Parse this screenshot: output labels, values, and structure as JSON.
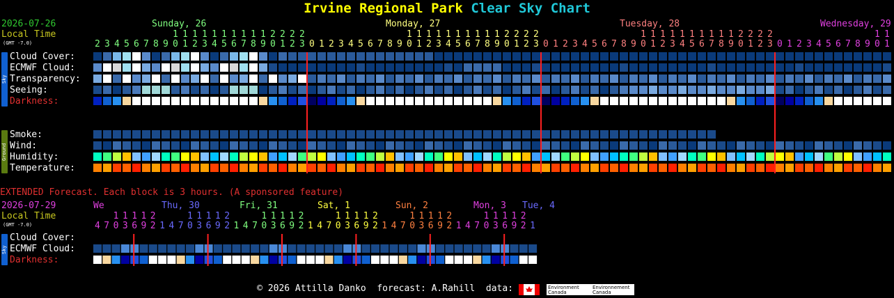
{
  "title": {
    "park": "Irvine Regional Park",
    "brand": "Clear Sky Chart"
  },
  "colors": {
    "park": "#ffff00",
    "brand": "#20c8d8",
    "date": "#30c830",
    "local": "#c8c820",
    "sunday": "#80ff80",
    "monday": "#ffff80",
    "tuesday": "#ff8080",
    "wednesday": "#e040e0",
    "midnight": "#ff2020",
    "extended": "#e03030",
    "eday1": "#e040e0"
  },
  "header": {
    "date": "2026-07-26",
    "local_time": "Local Time",
    "gmt": "(GMT -7.0)",
    "days": [
      {
        "label": "Sunday, 26",
        "color": "#80ff80",
        "col": 8
      },
      {
        "label": "Monday, 27",
        "color": "#ffff80",
        "col": 32
      },
      {
        "label": "Tuesday, 28",
        "color": "#ff8080",
        "col": 56
      },
      {
        "label": "Wednesday, 29",
        "color": "#e040e0",
        "col": 80
      }
    ],
    "hours_start": 2,
    "hours_count": 82
  },
  "sky_tab": "Sky",
  "ground_tab": "Ground",
  "rows": {
    "cloud": "Cloud Cover:",
    "ecmwf": "ECMWF Cloud:",
    "transparency": "Transparency:",
    "seeing": "Seeing:",
    "darkness": "Darkness:",
    "smoke": "Smoke:",
    "wind": "Wind:",
    "humidity": "Humidity:",
    "temperature": "Temperature:"
  },
  "extended": {
    "note": "EXTENDED Forecast. Each block is 3 hours. (A sponsored feature)",
    "date": "2026-07-29",
    "local_time": "Local Time",
    "gmt": "(GMT -7.0)",
    "days": [
      {
        "label": "We",
        "color": "#e040e0",
        "col": 0
      },
      {
        "label": "Thu, 30",
        "color": "#6a6aff",
        "col": 7
      },
      {
        "label": "Fri, 31",
        "color": "#80ff80",
        "col": 15
      },
      {
        "label": "Sat, 1",
        "color": "#ffff40",
        "col": 23
      },
      {
        "label": "Sun, 2",
        "color": "#ff8040",
        "col": 31
      },
      {
        "label": "Mon, 3",
        "color": "#e040e0",
        "col": 39
      },
      {
        "label": "Tue, 4",
        "color": "#6a6aff",
        "col": 44
      }
    ],
    "hours": [
      4,
      7,
      10,
      13,
      16,
      19,
      22,
      1,
      4,
      7,
      10,
      13,
      16,
      19,
      22,
      1,
      4,
      7,
      10,
      13,
      16,
      19,
      22,
      1,
      4,
      7,
      10,
      13,
      16,
      19,
      22,
      1,
      4,
      7,
      10,
      13,
      16,
      19,
      22,
      1,
      4,
      7,
      10,
      13,
      16,
      19,
      22,
      1
    ],
    "rows": {
      "cloud": "Cloud Cover:",
      "ecmwf": "ECMWF Cloud:",
      "darkness": "Darkness:"
    }
  },
  "footer": {
    "copyright": "© 2026 Attilla Danko",
    "forecast": "forecast: A.Rahill",
    "data": "data:",
    "logo_text": [
      "Environment",
      "Canada",
      "Environnement",
      "Canada"
    ]
  }
}
